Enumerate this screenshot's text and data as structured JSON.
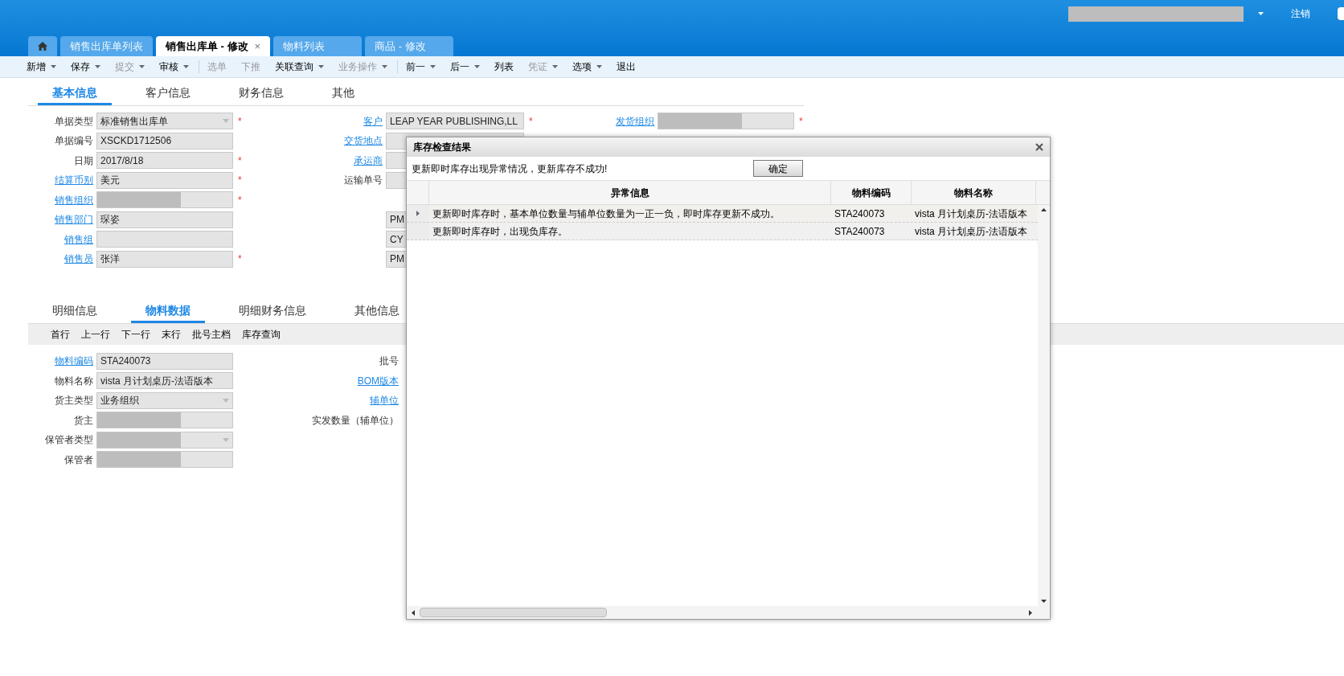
{
  "header": {
    "logout": "注销"
  },
  "page_tabs": [
    {
      "kind": "home",
      "selected": false
    },
    {
      "kind": "tab",
      "label": "销售出库单列表",
      "selected": false
    },
    {
      "kind": "tab",
      "label": "销售出库单 - 修改",
      "selected": true,
      "close": "×"
    },
    {
      "kind": "tab",
      "label": "物料列表",
      "selected": false
    },
    {
      "kind": "tab",
      "label": "商品 - 修改",
      "selected": false
    }
  ],
  "toolbar": [
    {
      "label": "新增",
      "menu": true,
      "disabled": false,
      "sep": false
    },
    {
      "label": "保存",
      "menu": true,
      "disabled": false,
      "sep": false
    },
    {
      "label": "提交",
      "menu": true,
      "disabled": true,
      "sep": false
    },
    {
      "label": "审核",
      "menu": true,
      "disabled": false,
      "sep": true
    },
    {
      "label": "选单",
      "menu": false,
      "disabled": true,
      "sep": false
    },
    {
      "label": "下推",
      "menu": false,
      "disabled": true,
      "sep": false
    },
    {
      "label": "关联查询",
      "menu": true,
      "disabled": false,
      "sep": false
    },
    {
      "label": "业务操作",
      "menu": true,
      "disabled": true,
      "sep": true
    },
    {
      "label": "前一",
      "menu": true,
      "disabled": false,
      "sep": false
    },
    {
      "label": "后一",
      "menu": true,
      "disabled": false,
      "sep": false
    },
    {
      "label": "列表",
      "menu": false,
      "disabled": false,
      "sep": false
    },
    {
      "label": "凭证",
      "menu": true,
      "disabled": true,
      "sep": false
    },
    {
      "label": "选项",
      "menu": true,
      "disabled": false,
      "sep": false
    },
    {
      "label": "退出",
      "menu": false,
      "disabled": false,
      "sep": false
    }
  ],
  "form_tabs": [
    {
      "label": "基本信息",
      "selected": true
    },
    {
      "label": "客户信息",
      "selected": false
    },
    {
      "label": "财务信息",
      "selected": false
    },
    {
      "label": "其他",
      "selected": false
    }
  ],
  "form_col_1": [
    {
      "label": "单据类型",
      "link": false,
      "value": "标准销售出库单",
      "kind": "select",
      "required": "*"
    },
    {
      "label": "单据编号",
      "link": false,
      "value": "XSCKD1712506",
      "kind": "text"
    },
    {
      "label": "日期",
      "link": false,
      "value": "2017/8/18",
      "kind": "text",
      "required": "*"
    },
    {
      "label": "结算币别",
      "link": true,
      "value": "美元",
      "kind": "text",
      "required": "*"
    },
    {
      "label": "销售组织",
      "link": true,
      "kind": "redacted",
      "required": "*"
    },
    {
      "label": "销售部门",
      "link": true,
      "value": "琛姿",
      "kind": "text"
    },
    {
      "label": "销售组",
      "link": true,
      "kind": "text"
    },
    {
      "label": "销售员",
      "link": true,
      "value": "张洋",
      "kind": "text",
      "required": "*"
    }
  ],
  "form_col_2": [
    {
      "label": "客户",
      "link": true,
      "value": "LEAP YEAR PUBLISHING,LL",
      "kind": "text",
      "required": "*"
    },
    {
      "label": "交货地点",
      "link": true,
      "kind": "text"
    },
    {
      "label": "承运商",
      "link": true,
      "kind": "text"
    },
    {
      "label": "运输单号",
      "link": false,
      "kind": "text"
    },
    {
      "kind": "blank"
    },
    {
      "value": "PM",
      "kind": "text"
    },
    {
      "value": "CY",
      "kind": "text"
    },
    {
      "value": "PM",
      "kind": "text"
    }
  ],
  "form_col_3": [
    {
      "label": "发货组织",
      "link": true,
      "kind": "redacted",
      "required": "*"
    }
  ],
  "detail_tabs": [
    {
      "label": "明细信息",
      "selected": false
    },
    {
      "label": "物料数据",
      "selected": true
    },
    {
      "label": "明细财务信息",
      "selected": false
    },
    {
      "label": "其他信息",
      "selected": false
    }
  ],
  "detail_toolbar": [
    "首行",
    "上一行",
    "下一行",
    "末行",
    "批号主档",
    "库存查询"
  ],
  "detail_col_1": [
    {
      "label": "物料编码",
      "link": true,
      "value": "STA240073",
      "kind": "text"
    },
    {
      "label": "物料名称",
      "link": false,
      "value": "vista 月计划桌历-法语版本",
      "kind": "text"
    },
    {
      "label": "货主类型",
      "link": false,
      "value": "业务组织",
      "kind": "select"
    },
    {
      "label": "货主",
      "link": false,
      "kind": "redacted"
    },
    {
      "label": "保管者类型",
      "link": false,
      "kind": "redacted_select"
    },
    {
      "label": "保管者",
      "link": false,
      "kind": "redacted"
    }
  ],
  "detail_col_2": [
    {
      "label": "批号",
      "link": false
    },
    {
      "label": "BOM版本",
      "link": true
    },
    {
      "label": "辅单位",
      "link": true
    },
    {
      "label": "实发数量（辅单位）",
      "link": false
    }
  ],
  "dialog": {
    "title": "库存检查结果",
    "message": "更新即时库存出现异常情况，更新库存不成功!",
    "ok": "确定",
    "columns": [
      "异常信息",
      "物料编码",
      "物料名称"
    ],
    "rows": [
      {
        "selected": true,
        "cells": [
          "更新即时库存时，基本单位数量与辅单位数量为一正一负，即时库存更新不成功。",
          "STA240073",
          "vista 月计划桌历-法语版本"
        ]
      },
      {
        "selected": false,
        "cells": [
          "更新即时库存时，出现负库存。",
          "STA240073",
          "vista 月计划桌历-法语版本"
        ]
      }
    ]
  }
}
